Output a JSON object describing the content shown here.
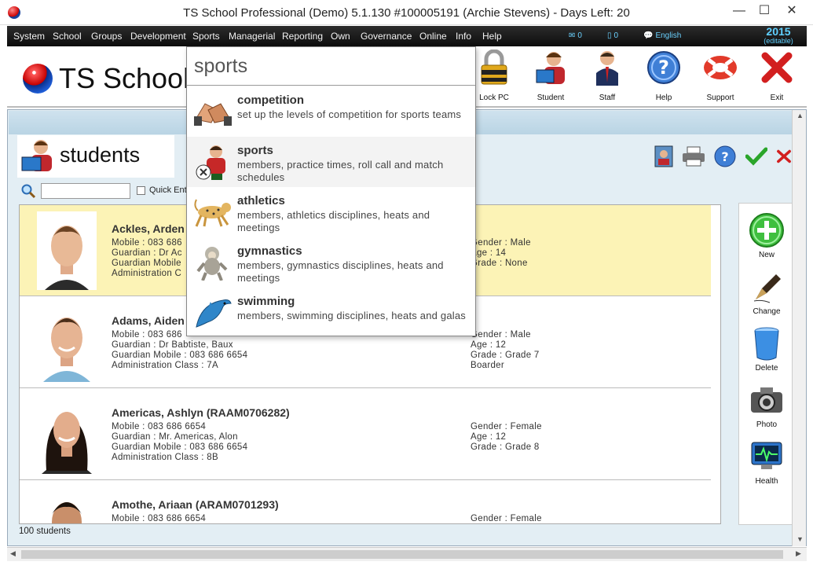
{
  "window": {
    "title": "TS School Professional (Demo) 5.1.130 #100005191 (Archie Stevens) - Days Left: 20",
    "minimize": "—",
    "maximize": "☐",
    "close": "✕"
  },
  "menu": {
    "items": [
      "System",
      "School",
      "Groups",
      "Development",
      "Sports",
      "Managerial",
      "Reporting",
      "Own",
      "Governance",
      "Online",
      "Info",
      "Help"
    ],
    "mail_count": "0",
    "phone_count": "0",
    "language": "English",
    "year": "2015",
    "year_note": "(editable)"
  },
  "brand": {
    "logo_text": "TS School"
  },
  "toolbar": {
    "buttons": [
      {
        "label": "Lock PC",
        "icon": "padlock-icon"
      },
      {
        "label": "Student",
        "icon": "student-icon"
      },
      {
        "label": "Staff",
        "icon": "staff-icon"
      },
      {
        "label": "Help",
        "icon": "help-icon"
      },
      {
        "label": "Support",
        "icon": "lifebuoy-icon"
      },
      {
        "label": "Exit",
        "icon": "exit-x-icon"
      }
    ]
  },
  "panel": {
    "header_fragment": "ts",
    "title": "students",
    "search_value": "",
    "quick_entry_label": "Quick Ent"
  },
  "students": [
    {
      "name": "Ackles, Arden",
      "left": [
        "Mobile : 083 686",
        "Guardian : Dr Ac",
        "Guardian Mobile",
        "Administration C"
      ],
      "right": [
        "Gender : Male",
        "Age : 14",
        "Grade : None"
      ],
      "selected": true
    },
    {
      "name": "Adams, Aiden",
      "left": [
        "Mobile : 083 686",
        "Guardian : Dr Babtiste, Baux",
        "Guardian Mobile : 083 686 6654",
        "Administration Class : 7A"
      ],
      "right": [
        "Gender : Male",
        "Age : 12",
        "Grade : Grade 7",
        "Boarder"
      ],
      "selected": false
    },
    {
      "name": "Americas, Ashlyn (RAAM0706282)",
      "left": [
        "Mobile : 083 686 6654",
        "Guardian : Mr. Americas, Alon",
        "Guardian Mobile : 083 686 6654",
        "Administration Class : 8B"
      ],
      "right": [
        "Gender : Female",
        "Age : 12",
        "Grade : Grade 8"
      ],
      "selected": false
    },
    {
      "name": "Amothe, Ariaan (ARAM0701293)",
      "left": [
        "Mobile : 083 686 6654"
      ],
      "right": [
        "Gender : Female"
      ],
      "selected": false
    }
  ],
  "status": {
    "count_text": "100 students"
  },
  "side_actions": [
    "New",
    "Change",
    "Delete",
    "Photo",
    "Health"
  ],
  "dropdown": {
    "search_text": "sports",
    "items": [
      {
        "title": "competition",
        "desc": "set up the levels of competition for sports teams",
        "icon": "handshake-icon"
      },
      {
        "title": "sports",
        "desc": "members, practice times, roll call and match schedules",
        "icon": "soccer-player-icon"
      },
      {
        "title": "athletics",
        "desc": "members, athletics disciplines, heats and meetings",
        "icon": "cheetah-icon"
      },
      {
        "title": "gymnastics",
        "desc": "members, gymnastics disciplines, heats and meetings",
        "icon": "monkey-icon"
      },
      {
        "title": "swimming",
        "desc": "members, swimming disciplines, heats and galas",
        "icon": "dolphin-icon"
      }
    ]
  },
  "colors": {
    "menubar": "#141414",
    "accent_blue": "#5fd0ff",
    "selected_row": "#fcf3b6",
    "header_band": "#c4dae8"
  }
}
